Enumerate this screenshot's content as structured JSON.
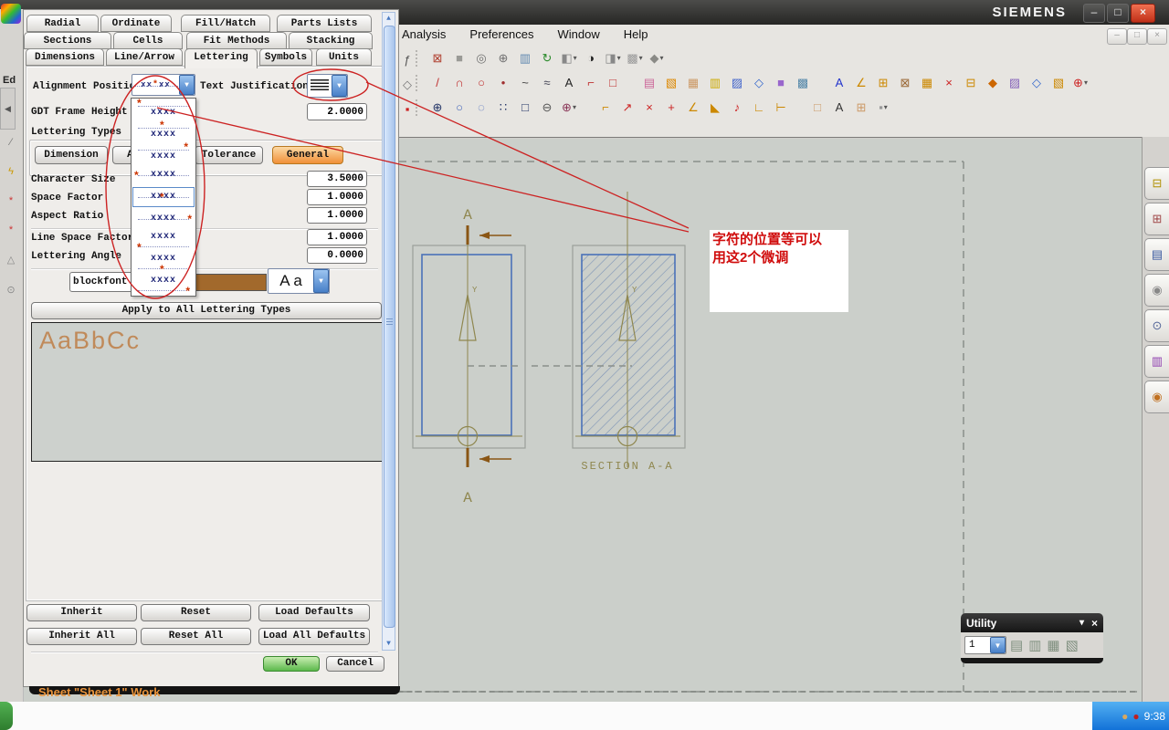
{
  "titlebar": {
    "brand": "SIEMENS"
  },
  "menubar": {
    "items": [
      "Analysis",
      "Preferences",
      "Window",
      "Help"
    ]
  },
  "icons": {
    "caret": "▼",
    "scroll_up": "▲",
    "scroll_down": "▼",
    "minimize": "–",
    "restore": "□",
    "close": "×",
    "utility_caret": "▾"
  },
  "toolbars": {
    "row1": [
      {
        "n": "fit-view-icon",
        "g": "⊠",
        "c": "#b04030"
      },
      {
        "n": "shaded-display-icon",
        "g": "■",
        "c": "#9a9a96"
      },
      {
        "n": "zoom-window-icon",
        "g": "◎",
        "c": "#707070"
      },
      {
        "n": "zoom-in-out-icon",
        "g": "⊕",
        "c": "#707070"
      },
      {
        "n": "pan-icon",
        "g": "▥",
        "c": "#6088b0"
      },
      {
        "n": "refresh-icon",
        "g": "↻",
        "c": "#2a8a2a"
      },
      {
        "n": "orient-view-icon",
        "g": "◧",
        "c": "#888",
        "cls": "dd"
      },
      {
        "n": "rotate-shade-icon",
        "g": "◑",
        "c": "#222"
      },
      {
        "n": "render-style-icon",
        "g": "◨",
        "c": "#888",
        "cls": "dd"
      },
      {
        "n": "background-icon",
        "g": "▩",
        "c": "#999",
        "cls": "dd"
      },
      {
        "n": "view-3d-icon",
        "g": "◆",
        "c": "#8a8a86",
        "cls": "dd"
      }
    ],
    "row2a": [
      {
        "n": "line-icon",
        "g": "/",
        "c": "#c03030"
      },
      {
        "n": "arc-icon",
        "g": "∩",
        "c": "#c03030"
      },
      {
        "n": "circle-icon",
        "g": "○",
        "c": "#c03030"
      },
      {
        "n": "point-icon",
        "g": "•",
        "c": "#a03030"
      },
      {
        "n": "spline-icon",
        "g": "~",
        "c": "#444"
      },
      {
        "n": "studio-spline-icon",
        "g": "≈",
        "c": "#445"
      },
      {
        "n": "text-icon",
        "g": "A",
        "c": "#222"
      },
      {
        "n": "fillet-icon",
        "g": "⌐",
        "c": "#c03030"
      },
      {
        "n": "rectangle-icon",
        "g": "□",
        "c": "#c03030"
      }
    ],
    "row2b": [
      {
        "n": "sketch-icon",
        "g": "▤",
        "c": "#cc6699"
      },
      {
        "n": "extrude-icon",
        "g": "▧",
        "c": "#dd8800"
      },
      {
        "n": "hole-icon",
        "g": "▦",
        "c": "#cc9966"
      },
      {
        "n": "pattern-icon",
        "g": "▥",
        "c": "#ccaa00"
      },
      {
        "n": "block-icon",
        "g": "▨",
        "c": "#4466cc"
      },
      {
        "n": "unite-icon",
        "g": "◇",
        "c": "#3366cc"
      },
      {
        "n": "datum-plane-icon",
        "g": "■",
        "c": "#9966cc"
      },
      {
        "n": "trim-body-icon",
        "g": "▩",
        "c": "#5588aa"
      }
    ],
    "row2c": [
      {
        "n": "note-icon",
        "g": "A",
        "c": "#2233cc"
      },
      {
        "n": "angular-dim-icon",
        "g": "∠",
        "c": "#cc8800"
      },
      {
        "n": "inferred-dim-icon",
        "g": "⊞",
        "c": "#cc8800"
      },
      {
        "n": "frame-dim-icon",
        "g": "⊠",
        "c": "#996633"
      },
      {
        "n": "table-icon",
        "g": "▦",
        "c": "#cc8800"
      },
      {
        "n": "weld-symbol-icon",
        "g": "×",
        "c": "#cc2222"
      },
      {
        "n": "ordinate-dim-icon",
        "g": "⊟",
        "c": "#cc8800"
      },
      {
        "n": "feature-control-icon",
        "g": "◆",
        "c": "#cc6600"
      },
      {
        "n": "image-icon",
        "g": "▨",
        "c": "#8866bb"
      },
      {
        "n": "symbol-icon",
        "g": "◇",
        "c": "#3366cc"
      },
      {
        "n": "hatch-icon",
        "g": "▧",
        "c": "#cc8800"
      },
      {
        "n": "centerline-icon",
        "g": "⊕",
        "c": "#cc2222",
        "cls": "dd"
      }
    ],
    "row3a": [
      {
        "n": "point-constructor-icon",
        "g": "⊕",
        "c": "#223366"
      },
      {
        "n": "blend-icon",
        "g": "○",
        "c": "#4466bb"
      },
      {
        "n": "dashed-circle-icon",
        "g": "◌",
        "c": "#4466bb"
      },
      {
        "n": "measure-icon",
        "g": "∷",
        "c": "#223366"
      },
      {
        "n": "sheet-icon",
        "g": "□",
        "c": "#223366"
      },
      {
        "n": "cylinder-icon",
        "g": "⊖",
        "c": "#555"
      },
      {
        "n": "csys-icon",
        "g": "⊕",
        "c": "#883355",
        "cls": "dd"
      }
    ],
    "row3b": [
      {
        "n": "edit-dim-icon",
        "g": "⌐",
        "c": "#cc8800"
      },
      {
        "n": "leader-icon",
        "g": "↗",
        "c": "#cc2222"
      },
      {
        "n": "delete-icon",
        "g": "×",
        "c": "#cc2222"
      },
      {
        "n": "add-icon",
        "g": "+",
        "c": "#cc2222"
      },
      {
        "n": "angle-tool-icon",
        "g": "∠",
        "c": "#cc8800"
      },
      {
        "n": "corner-tool-icon",
        "g": "◣",
        "c": "#cc8800"
      },
      {
        "n": "jingle-icon",
        "g": "♪",
        "c": "#cc2222"
      },
      {
        "n": "right-angle-icon",
        "g": "∟",
        "c": "#cc8800"
      },
      {
        "n": "tack-icon",
        "g": "⊢",
        "c": "#cc8800"
      }
    ],
    "row3c": [
      {
        "n": "view-boundary-icon",
        "g": "□",
        "c": "#cc9966"
      },
      {
        "n": "text-edit-icon",
        "g": "A",
        "c": "#333"
      },
      {
        "n": "grid-icon",
        "g": "⊞",
        "c": "#cc9966"
      },
      {
        "n": "dot-icon",
        "g": "▪",
        "c": "#999",
        "cls": "dd"
      }
    ],
    "edge": [
      {
        "n": "hidden-tool-icon",
        "g": "ƒ",
        "c": "#555"
      },
      {
        "n": "hidden-tool-icon",
        "g": "◇",
        "c": "#777"
      },
      {
        "n": "hidden-tool-icon",
        "g": "▪",
        "c": "#cc2222"
      }
    ]
  },
  "left_strip": {
    "label": "Ed",
    "items": [
      {
        "n": "strip-tool-icon",
        "g": "∕",
        "c": "#777"
      },
      {
        "n": "strip-tool-icon",
        "g": "ϟ",
        "c": "#cc9900"
      },
      {
        "n": "strip-tool-icon",
        "g": "*",
        "c": "#cc3333"
      },
      {
        "n": "strip-tool-icon",
        "g": "*",
        "c": "#cc3333"
      },
      {
        "n": "strip-tool-icon",
        "g": "△",
        "c": "#888"
      },
      {
        "n": "strip-tool-icon",
        "g": "⊙",
        "c": "#888"
      }
    ]
  },
  "dialog": {
    "tabs": {
      "row1": [
        "Radial",
        "Ordinate",
        "Fill/Hatch",
        "Parts Lists"
      ],
      "row2": [
        "Sections",
        "Cells",
        "Fit Methods",
        "Stacking"
      ],
      "row3": [
        "Dimensions",
        "Line/Arrow",
        "Lettering",
        "Symbols",
        "Units"
      ]
    },
    "active_tab": "Lettering",
    "labels": {
      "alignment_position": "Alignment Position",
      "text_justification": "Text Justification",
      "gdt": "GDT Frame Height Factor",
      "lettering_types": "Lettering Types"
    },
    "align": {
      "label": "xxxx",
      "half": "xx",
      "marker": "*",
      "selected": "middle-center"
    },
    "gdt_value": "2.0000",
    "type_buttons": [
      "Dimension",
      "Appended Text",
      "Tolerance",
      "General"
    ],
    "active_type": "General",
    "params": [
      {
        "label": "Character Size",
        "value": "3.5000"
      },
      {
        "label": "Space Factor",
        "value": "1.0000"
      },
      {
        "label": "Aspect Ratio",
        "value": "1.0000"
      },
      {
        "label": "Line Space Factor",
        "value": "1.0000"
      },
      {
        "label": "Lettering Angle",
        "value": "0.0000"
      }
    ],
    "font_name": "blockfont",
    "color_swatch": "#a2692c",
    "char_sample": "A a",
    "apply_button": "Apply to All Lettering Types",
    "preview_text": "AaBbCc",
    "buttons": {
      "inherit": "Inherit",
      "reset": "Reset",
      "load_defaults": "Load Defaults",
      "inherit_all": "Inherit All",
      "reset_all": "Reset All",
      "load_all_defaults": "Load All Defaults",
      "ok": "OK",
      "cancel": "Cancel"
    }
  },
  "drawing": {
    "a_top": "A",
    "a_bottom": "A",
    "y_left": "Y",
    "y_right": "Y",
    "section_label": "SECTION A-A"
  },
  "annotation": {
    "line1": "字符的位置等可以",
    "line2": "用这2个微调",
    "color": "#d00d0d"
  },
  "utility": {
    "title": "Utility",
    "combo_value": "1",
    "icons": [
      {
        "n": "layer-copy-icon",
        "g": "▤",
        "c": "#7f8f7f"
      },
      {
        "n": "layer-paste-icon",
        "g": "▥",
        "c": "#7f8f7f"
      },
      {
        "n": "layer-settings-icon",
        "g": "▦",
        "c": "#7f8f7f"
      },
      {
        "n": "layer-visible-icon",
        "g": "▧",
        "c": "#7f8f7f"
      }
    ]
  },
  "resource_tabs": [
    {
      "n": "assembly-navigator-tab",
      "g": "⊟",
      "c": "#b09000"
    },
    {
      "n": "constraint-navigator-tab",
      "g": "⊞",
      "c": "#a04848"
    },
    {
      "n": "part-navigator-tab",
      "g": "▤",
      "c": "#3858a0"
    },
    {
      "n": "reuse-library-tab",
      "g": "◉",
      "c": "#888"
    },
    {
      "n": "history-tab",
      "g": "⊙",
      "c": "#556699"
    },
    {
      "n": "palettes-tab",
      "g": "▥",
      "c": "#9040b0"
    },
    {
      "n": "roles-tab",
      "g": "◉",
      "c": "#c07020"
    }
  ],
  "statusline": {
    "sheet_text": "Sheet \"Sheet 1\" Work"
  },
  "taskbar": {
    "time": "9:38",
    "tray_icons": [
      {
        "n": "tray-volume-icon",
        "g": "●",
        "c": "#d8a860"
      },
      {
        "n": "tray-security-icon",
        "g": "●",
        "c": "#c02020"
      }
    ]
  }
}
